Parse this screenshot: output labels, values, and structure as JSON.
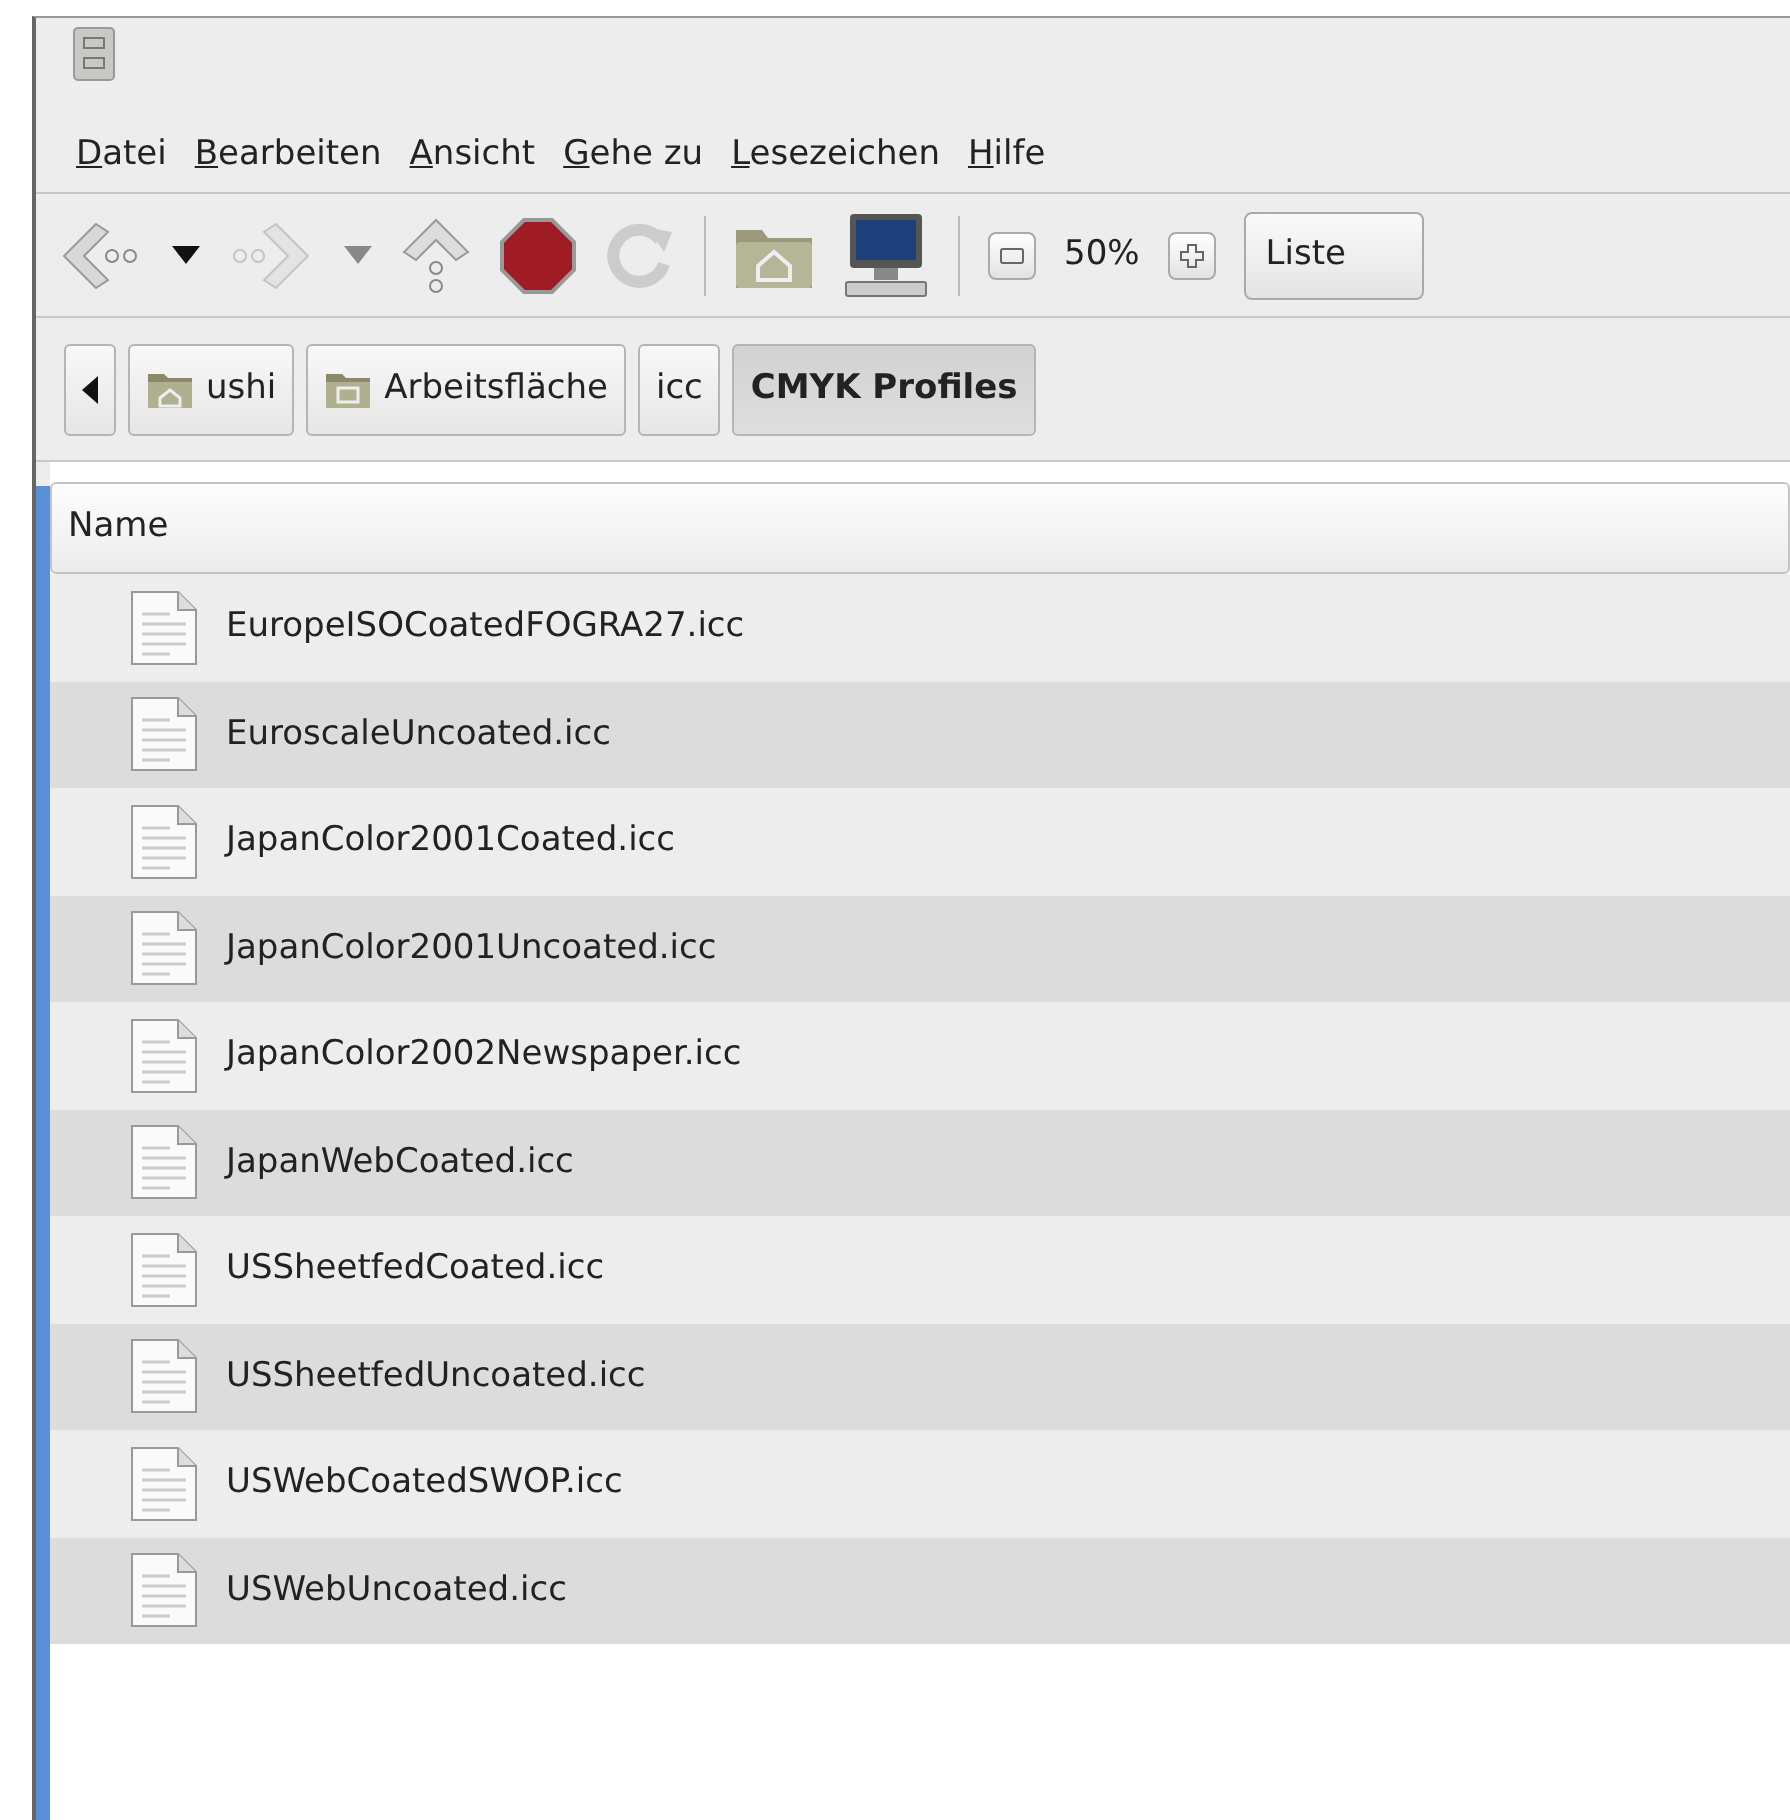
{
  "menu": [
    {
      "label": "Datei"
    },
    {
      "label": "Bearbeiten"
    },
    {
      "label": "Ansicht"
    },
    {
      "label": "Gehe zu"
    },
    {
      "label": "Lesezeichen"
    },
    {
      "label": "Hilfe"
    }
  ],
  "toolbar": {
    "back": {
      "disabled": false
    },
    "forward": {
      "disabled": true
    },
    "zoom": "50%",
    "view_mode": "Liste"
  },
  "path": [
    {
      "label": "ushi",
      "kind": "home",
      "selected": false
    },
    {
      "label": "Arbeitsfläche",
      "kind": "desktop",
      "selected": false
    },
    {
      "label": "icc",
      "kind": "plain",
      "selected": false
    },
    {
      "label": "CMYK Profiles",
      "kind": "plain",
      "selected": true
    }
  ],
  "table": {
    "columns": [
      "Name"
    ],
    "rows": [
      {
        "name": "EuropeISOCoatedFOGRA27.icc"
      },
      {
        "name": "EuroscaleUncoated.icc"
      },
      {
        "name": "JapanColor2001Coated.icc"
      },
      {
        "name": "JapanColor2001Uncoated.icc"
      },
      {
        "name": "JapanColor2002Newspaper.icc"
      },
      {
        "name": "JapanWebCoated.icc"
      },
      {
        "name": "USSheetfedCoated.icc"
      },
      {
        "name": "USSheetfedUncoated.icc"
      },
      {
        "name": "USWebCoatedSWOP.icc"
      },
      {
        "name": "USWebUncoated.icc"
      }
    ]
  }
}
